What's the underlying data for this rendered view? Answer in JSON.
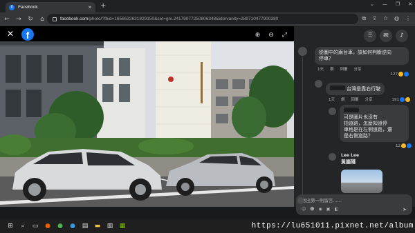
{
  "browser": {
    "tab_title": "Facebook",
    "new_tab": "+",
    "url_host": "facebook.com",
    "url_path": "/photo/?fbid=1656632631829150&set=gm.24179077250806348&idorvanity=289710477900380"
  },
  "viewer": {
    "close": "✕",
    "logo": "f"
  },
  "comments": [
    {
      "text_line1": "從圖中的兩台車，該如何判斷逆向",
      "text_line2": "停車？",
      "time": "1天",
      "like": "讚",
      "reply": "回覆",
      "share": "分享",
      "reactions": "127"
    },
    {
      "text": "台灣是靠右行駛",
      "time": "1天",
      "like": "讚",
      "reply": "回覆",
      "share": "分享",
      "reactions": "191"
    },
    {
      "text_lines": [
        "可是圖片也沒有",
        "拍道路，怎麼知道停",
        "車格是在左側道路，還",
        "是右側道路？"
      ],
      "reactions": "12"
    },
    {
      "name": "Lee Lee",
      "text": "黃腦殘"
    }
  ],
  "reply_box": {
    "placeholder": "送出第一則留言......"
  },
  "watermark": "https://lu651011.pixnet.net/album",
  "colors": {
    "facebook_blue": "#1877f2",
    "panel_bg": "#242526",
    "bubble_bg": "#3a3b3c"
  }
}
